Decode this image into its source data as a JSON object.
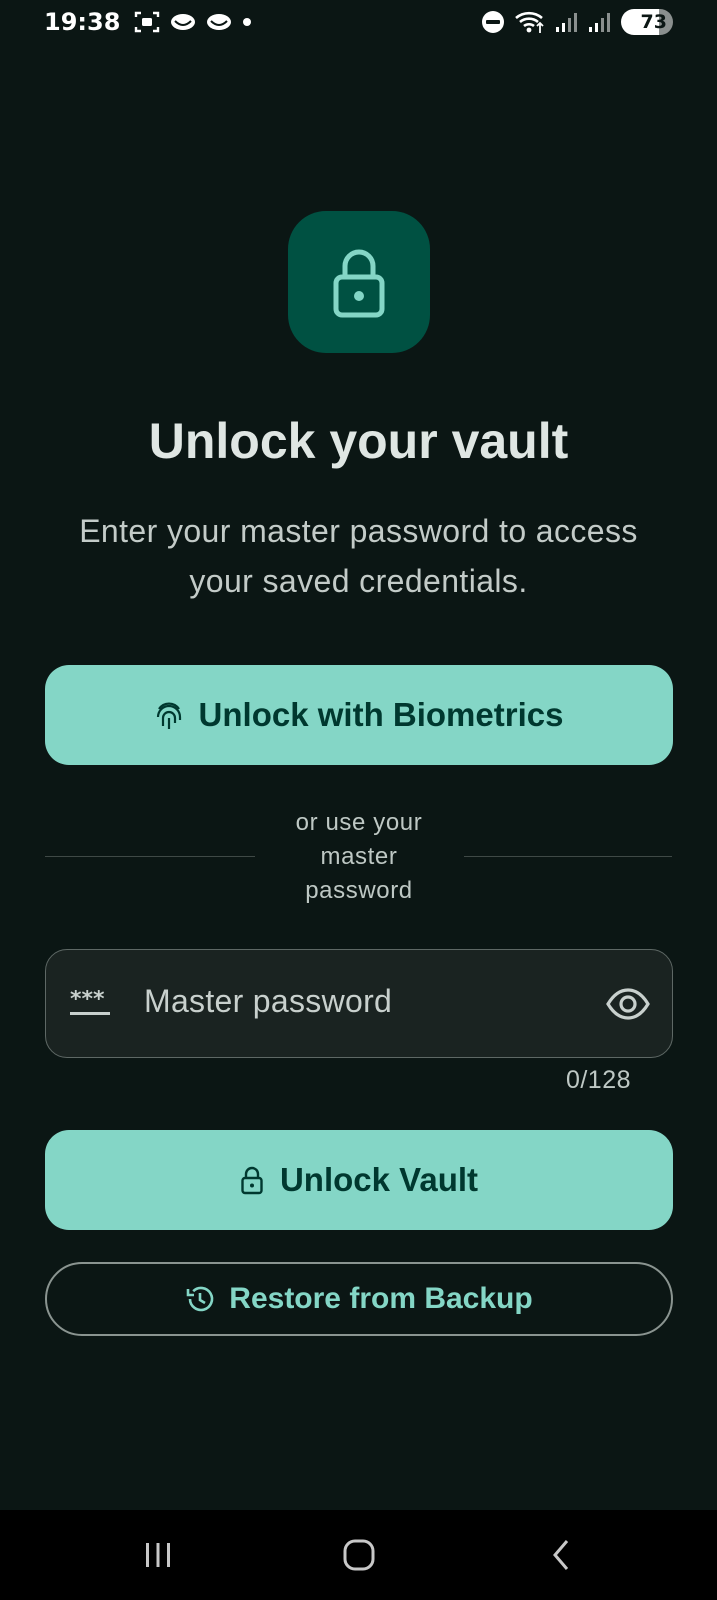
{
  "status_bar": {
    "time": "19:38",
    "battery": "73",
    "icons": [
      "screenshot-icon",
      "notification-app-icon",
      "notification-app-icon",
      "dot-icon",
      "do-not-disturb-icon",
      "wifi-icon",
      "signal-icon",
      "signal-icon",
      "battery-icon"
    ]
  },
  "hero": {
    "icon": "lock-icon",
    "title": "Unlock your vault",
    "subtitle": "Enter your master password to access your saved credentials."
  },
  "biometric_button": {
    "label": "Unlock with Biometrics",
    "icon": "fingerprint-icon"
  },
  "divider": {
    "text": "or use your master password"
  },
  "password_field": {
    "placeholder": "Master password",
    "value": "",
    "counter": "0/128",
    "leading_icon": "password-icon",
    "trailing_icon": "eye-icon"
  },
  "unlock_button": {
    "label": "Unlock Vault",
    "icon": "lock-icon"
  },
  "restore_button": {
    "label": "Restore from Backup",
    "icon": "history-icon"
  },
  "nav_bar": {
    "buttons": [
      "recents-icon",
      "home-icon",
      "back-icon"
    ]
  },
  "colors": {
    "background": "#0b1614",
    "accent": "#84d6c6",
    "on_accent": "#00382f",
    "icon_container": "#005142",
    "icon_tint": "#84d6c6",
    "field_bg": "#1a2321"
  }
}
